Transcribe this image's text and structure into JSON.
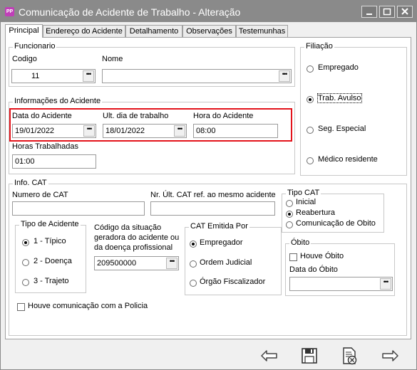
{
  "window": {
    "app_icon": "PP",
    "title": "Comunicação de Acidente de Trabalho - Alteração",
    "buttons": [
      "minimize-icon",
      "maximize-icon",
      "close-icon"
    ]
  },
  "tabs": [
    "Principal",
    "Endereço do Acidente",
    "Detalhamento",
    "Observações",
    "Testemunhas"
  ],
  "funcionario": {
    "group": "Funcionario",
    "codigo_label": "Codigo",
    "codigo_value": "11",
    "nome_label": "Nome",
    "nome_value": ""
  },
  "informacoes": {
    "group": "Informações do Acidente",
    "data_label": "Data do Acidente",
    "data_value": "19/01/2022",
    "ult_label": "Ult. dia de trabalho",
    "ult_value": "18/01/2022",
    "hora_label": "Hora do Acidente",
    "hora_value": "08:00",
    "horas_label": "Horas Trabalhadas",
    "horas_value": "01:00"
  },
  "filiacao": {
    "group": "Filiação",
    "options": [
      "Empregado",
      "Trab. Avulso",
      "Seg. Especial",
      "Médico residente"
    ],
    "selected": "Trab. Avulso"
  },
  "info_cat": {
    "group": "Info. CAT",
    "numero_label": "Numero de CAT",
    "numero_value": "",
    "nr_ult_label": "Nr. Últ. CAT ref. ao mesmo acidente",
    "nr_ult_value": "",
    "tipo_cat": {
      "group": "Tipo CAT",
      "options": [
        "Inicial",
        "Reabertura",
        "Comunicação de Obito"
      ],
      "selected": "Reabertura"
    },
    "tipo_acidente": {
      "group": "Tipo de Acidente",
      "options": [
        "1 - Típico",
        "2 - Doença",
        "3 - Trajeto"
      ],
      "selected": "1 - Típico"
    },
    "codigo_situacao": {
      "label_lines": [
        "Código da situação",
        "geradora do acidente ou",
        "da doença profissional"
      ],
      "value": "209500000"
    },
    "cat_emitida": {
      "group": "CAT Emitida Por",
      "options": [
        "Empregador",
        "Ordem Judicial",
        "Órgão Fiscalizador"
      ],
      "selected": "Empregador"
    },
    "obito": {
      "group": "Óbito",
      "houve_label": "Houve Óbito",
      "houve_checked": false,
      "data_label": "Data do Óbito",
      "data_value": ""
    },
    "policia_label": "Houve comunicação com a Policia",
    "policia_checked": false
  },
  "toolbar": [
    "previous-arrow-icon",
    "save-disk-icon",
    "cancel-document-icon",
    "next-arrow-icon"
  ],
  "colors": {
    "titlebar": "#8a8a8a",
    "highlight": "#e3121a",
    "app_icon": "#c03fb8"
  }
}
